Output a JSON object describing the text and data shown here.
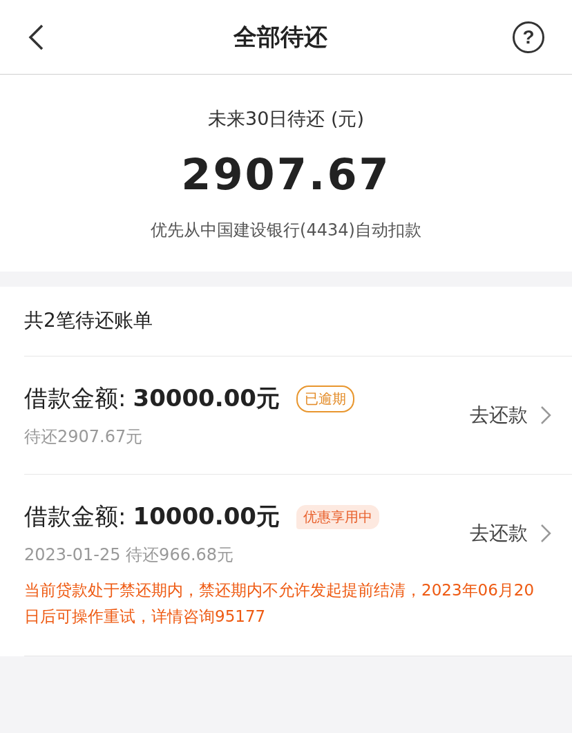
{
  "header": {
    "title": "全部待还",
    "help": "?"
  },
  "summary": {
    "label": "未来30日待还 (元)",
    "amount": "2907.67",
    "note": "优先从中国建设银行(4434)自动扣款"
  },
  "bills": {
    "title": "共2笔待还账单",
    "items": [
      {
        "label": "借款金额:",
        "amount": "30000.00元",
        "badge": {
          "text": "已逾期",
          "kind": "outline"
        },
        "detail": "待还2907.67元",
        "action": "去还款"
      },
      {
        "label": "借款金额:",
        "amount": "10000.00元",
        "badge": {
          "text": "优惠享用中",
          "kind": "filled"
        },
        "detail": "2023-01-25 待还966.68元",
        "action": "去还款",
        "warning": "当前贷款处于禁还期内，禁还期内不允许发起提前结清，2023年06月20日后可操作重试，详情咨询95177"
      }
    ]
  }
}
